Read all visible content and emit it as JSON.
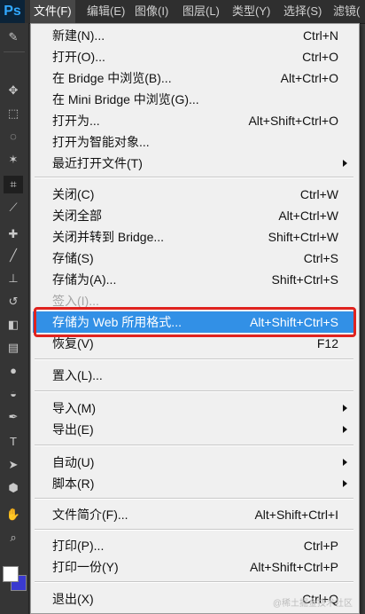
{
  "app": {
    "logo": "Ps"
  },
  "menubar": [
    {
      "label": "文件(F)"
    },
    {
      "label": "编辑(E)"
    },
    {
      "label": "图像(I)"
    },
    {
      "label": "图层(L)"
    },
    {
      "label": "类型(Y)"
    },
    {
      "label": "选择(S)"
    },
    {
      "label": "滤镜("
    }
  ],
  "toolbar": {
    "tools": [
      "move-tool-icon",
      "marquee-tool-icon",
      "lasso-tool-icon",
      "magic-wand-icon",
      "crop-tool-icon",
      "eyedropper-icon",
      "healing-brush-icon",
      "brush-tool-icon",
      "clone-stamp-icon",
      "history-brush-icon",
      "eraser-icon",
      "gradient-icon",
      "blur-icon",
      "dodge-icon",
      "pen-tool-icon",
      "type-tool-icon",
      "path-select-icon",
      "shape-tool-icon",
      "hand-tool-icon",
      "zoom-tool-icon"
    ],
    "foreground_color": "#ffffff",
    "background_color": "#3a3ad0"
  },
  "file_menu": {
    "items": [
      {
        "label": "新建(N)...",
        "shortcut": "Ctrl+N"
      },
      {
        "label": "打开(O)...",
        "shortcut": "Ctrl+O"
      },
      {
        "label": "在 Bridge 中浏览(B)...",
        "shortcut": "Alt+Ctrl+O"
      },
      {
        "label": "在 Mini Bridge 中浏览(G)...",
        "shortcut": ""
      },
      {
        "label": "打开为...",
        "shortcut": "Alt+Shift+Ctrl+O"
      },
      {
        "label": "打开为智能对象...",
        "shortcut": ""
      },
      {
        "label": "最近打开文件(T)",
        "shortcut": ""
      },
      {
        "label": "关闭(C)",
        "shortcut": "Ctrl+W"
      },
      {
        "label": "关闭全部",
        "shortcut": "Alt+Ctrl+W"
      },
      {
        "label": "关闭并转到 Bridge...",
        "shortcut": "Shift+Ctrl+W"
      },
      {
        "label": "存储(S)",
        "shortcut": "Ctrl+S"
      },
      {
        "label": "存储为(A)...",
        "shortcut": "Shift+Ctrl+S"
      },
      {
        "label": "签入(I)...",
        "shortcut": ""
      },
      {
        "label": "存储为 Web 所用格式...",
        "shortcut": "Alt+Shift+Ctrl+S"
      },
      {
        "label": "恢复(V)",
        "shortcut": "F12"
      },
      {
        "label": "置入(L)...",
        "shortcut": ""
      },
      {
        "label": "导入(M)",
        "shortcut": ""
      },
      {
        "label": "导出(E)",
        "shortcut": ""
      },
      {
        "label": "自动(U)",
        "shortcut": ""
      },
      {
        "label": "脚本(R)",
        "shortcut": ""
      },
      {
        "label": "文件简介(F)...",
        "shortcut": "Alt+Shift+Ctrl+I"
      },
      {
        "label": "打印(P)...",
        "shortcut": "Ctrl+P"
      },
      {
        "label": "打印一份(Y)",
        "shortcut": "Alt+Shift+Ctrl+P"
      },
      {
        "label": "退出(X)",
        "shortcut": "Ctrl+Q"
      }
    ]
  },
  "watermark": "@稀土掘金技术社区",
  "colors": {
    "highlight": "#3290e6",
    "annotation_border": "#e0231f"
  }
}
